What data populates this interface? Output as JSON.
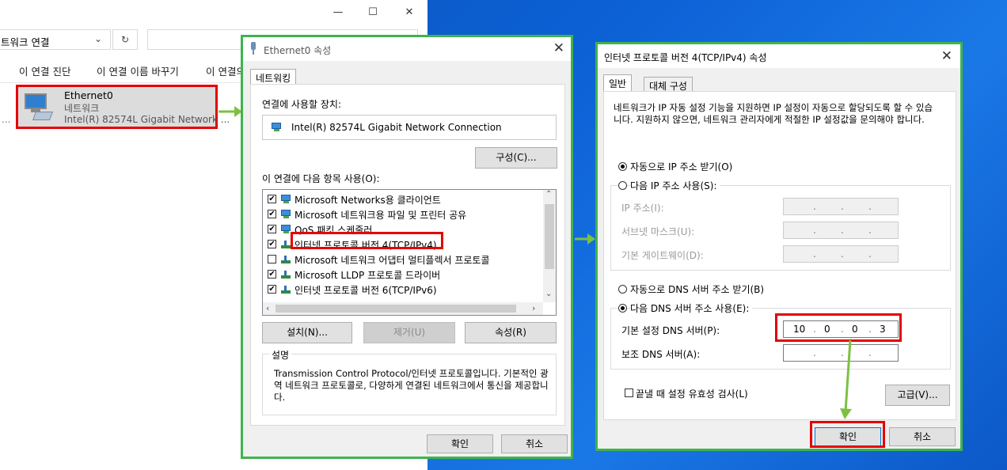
{
  "explorer": {
    "address": "트워크 연결",
    "toolbar": {
      "diagnose": "이 연결 진단",
      "rename": "이 연결 이름 바꾸기",
      "status": "이 연결의"
    },
    "adapter": {
      "name": "Ethernet0",
      "type": "네트워크",
      "device": "Intel(R) 82574L Gigabit Network ..."
    },
    "bottom_dots": "..."
  },
  "eth_props": {
    "title": "Ethernet0 속성",
    "tab": "네트워킹",
    "connect_using_label": "연결에 사용할 장치:",
    "device": "Intel(R) 82574L Gigabit Network Connection",
    "configure": "구성(C)...",
    "items_label": "이 연결에 다음 항목 사용(O):",
    "items": [
      {
        "label": "Microsoft Networks용 클라이언트",
        "checked": true,
        "icon": "network-client-icon"
      },
      {
        "label": "Microsoft 네트워크용 파일 및 프린터 공유",
        "checked": true,
        "icon": "file-share-icon"
      },
      {
        "label": "QoS 패킷 스케줄러",
        "checked": true,
        "icon": "qos-icon"
      },
      {
        "label": "인터넷 프로토콜 버전 4(TCP/IPv4)",
        "checked": true,
        "icon": "protocol-icon"
      },
      {
        "label": "Microsoft 네트워크 어댑터 멀티플렉서 프로토콜",
        "checked": false,
        "icon": "protocol-icon"
      },
      {
        "label": "Microsoft LLDP 프로토콜 드라이버",
        "checked": true,
        "icon": "protocol-icon"
      },
      {
        "label": "인터넷 프로토콜 버전 6(TCP/IPv6)",
        "checked": true,
        "icon": "protocol-icon"
      }
    ],
    "install": "설치(N)...",
    "uninstall": "제거(U)",
    "properties": "속성(R)",
    "desc_label": "설명",
    "description": "Transmission Control Protocol/인터넷 프로토콜입니다. 기본적인 광역 네트워크 프로토콜로, 다양하게 연결된 네트워크에서 통신을 제공합니다.",
    "ok": "확인",
    "cancel": "취소"
  },
  "ipv4": {
    "title": "인터넷 프로토콜 버전 4(TCP/IPv4) 속성",
    "tab_general": "일반",
    "tab_alternate": "대체 구성",
    "intro": "네트워크가 IP 자동 설정 기능을 지원하면 IP 설정이 자동으로 할당되도록 할 수 있습니다. 지원하지 않으면, 네트워크 관리자에게 적절한 IP 설정값을 문의해야 합니다.",
    "auto_ip": "자동으로 IP 주소 받기(O)",
    "manual_ip": "다음 IP 주소 사용(S):",
    "ip_label": "IP 주소(I):",
    "subnet_label": "서브넷 마스크(U):",
    "gateway_label": "기본 게이트웨이(D):",
    "auto_dns": "자동으로 DNS 서버 주소 받기(B)",
    "manual_dns": "다음 DNS 서버 주소 사용(E):",
    "pref_dns_label": "기본 설정 DNS 서버(P):",
    "pref_dns": [
      "10",
      "0",
      "0",
      "3"
    ],
    "alt_dns_label": "보조 DNS 서버(A):",
    "validate": "끝낼 때 설정 유효성 검사(L)",
    "advanced": "고급(V)...",
    "ok": "확인",
    "cancel": "취소"
  },
  "colors": {
    "highlight": "#e60000",
    "dialog_border": "#3fb34f",
    "arrow": "#7cc142"
  }
}
